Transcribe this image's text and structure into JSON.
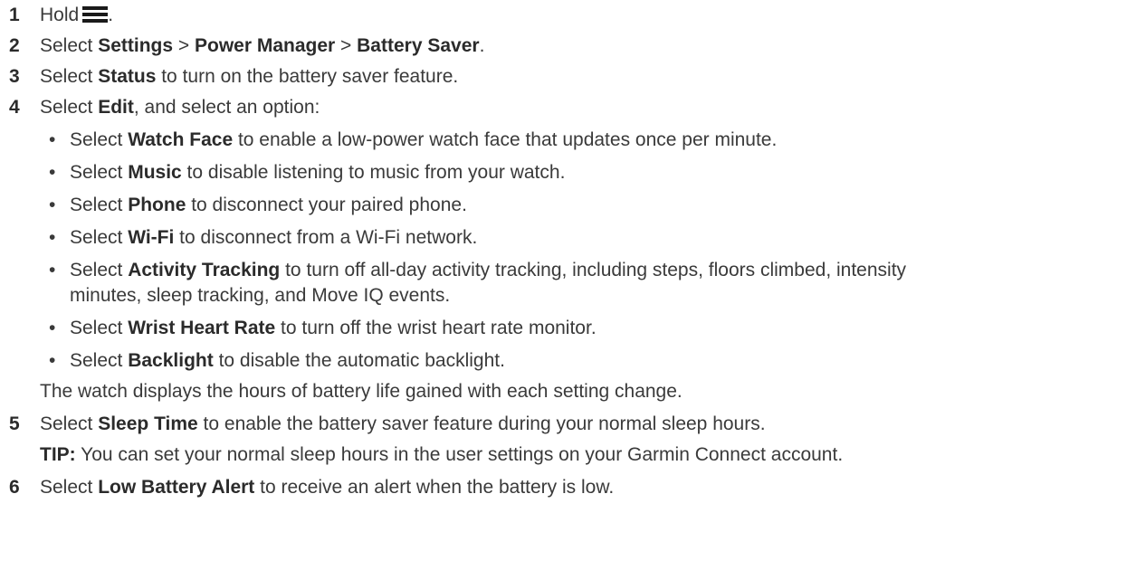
{
  "steps": {
    "s1": {
      "num": "1",
      "pre": "Hold",
      "post": ".",
      "icon": "menu-icon"
    },
    "s2": {
      "num": "2",
      "pre": "Select ",
      "b1": "Settings",
      "sep1": " > ",
      "b2": "Power Manager",
      "sep2": " > ",
      "b3": "Battery Saver",
      "post": "."
    },
    "s3": {
      "num": "3",
      "pre": "Select ",
      "b1": "Status",
      "post": " to turn on the battery saver feature."
    },
    "s4": {
      "num": "4",
      "pre": "Select ",
      "b1": "Edit",
      "post": ", and select an option:"
    },
    "s5": {
      "num": "5",
      "pre": "Select ",
      "b1": "Sleep Time",
      "post": " to enable the battery saver feature during your normal sleep hours."
    },
    "s6": {
      "num": "6",
      "pre": "Select ",
      "b1": "Low Battery Alert",
      "post": " to receive an alert when the battery is low."
    }
  },
  "bullet_char": "•",
  "options": [
    {
      "pre": "Select ",
      "bold": "Watch Face",
      "post": " to enable a low-power watch face that updates once per minute."
    },
    {
      "pre": "Select ",
      "bold": "Music",
      "post": " to disable listening to music from your watch."
    },
    {
      "pre": "Select ",
      "bold": "Phone",
      "post": " to disconnect your paired phone."
    },
    {
      "pre": "Select ",
      "bold": "Wi-Fi",
      "post": " to disconnect from a Wi-Fi network."
    },
    {
      "pre": "Select ",
      "bold": "Activity Tracking",
      "post": " to turn off all-day activity tracking, including steps, floors climbed, intensity",
      "cont": "minutes, sleep tracking, and Move IQ events."
    },
    {
      "pre": "Select ",
      "bold": "Wrist Heart Rate",
      "post": " to turn off the wrist heart rate monitor."
    },
    {
      "pre": "Select ",
      "bold": "Backlight",
      "post": " to disable the automatic backlight."
    }
  ],
  "note_after_options": "The watch displays the hours of battery life gained with each setting change.",
  "tip": {
    "label": "TIP:",
    "text": " You can set your normal sleep hours in the user settings on your Garmin Connect account."
  }
}
